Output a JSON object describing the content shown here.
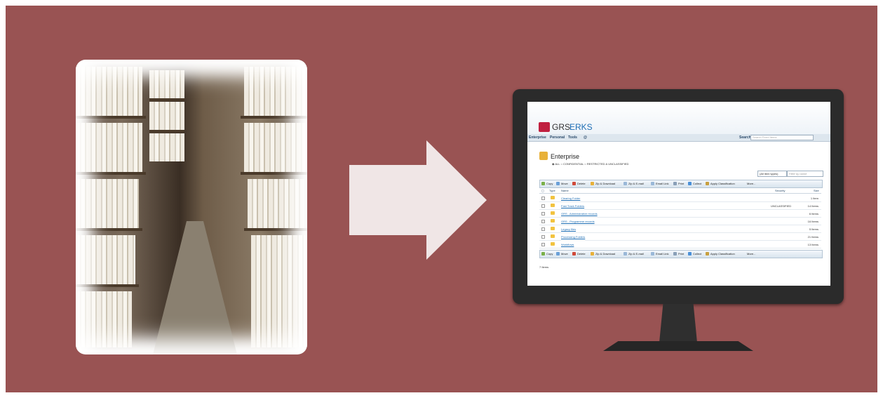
{
  "app": {
    "logo_primary": "GRS",
    "logo_secondary": "ERKS"
  },
  "nav": {
    "items": [
      "Enterprise",
      "Personal",
      "Tools",
      "@"
    ],
    "search_label": "Search",
    "search_placeholder": "Search Fixed Items"
  },
  "container": {
    "title": "Enterprise",
    "radio_options": "◉ ALL ○ CONFIDENTIAL ○ RESTRICTED & UNCLASSIFIED",
    "type_filter": "(All item types)",
    "name_filter_placeholder": "Filter by name"
  },
  "toolbar": [
    "Copy",
    "Move",
    "Delete",
    "Zip & Download",
    "Zip & E-mail",
    "Email Link",
    "Print",
    "Collect",
    "Apply Classification",
    "More..."
  ],
  "columns": {
    "type": "Type",
    "name": "Name",
    "security": "Security",
    "size": "Size"
  },
  "rows": [
    {
      "name": "Clearing Folder",
      "security": "",
      "size": "1 Item"
    },
    {
      "name": "Fast Track Folders",
      "security": "UNCLASSIFIED",
      "size": "14 Items"
    },
    {
      "name": "GRS - Administrative records",
      "security": "",
      "size": "6 Items"
    },
    {
      "name": "GRS - Programme records",
      "security": "",
      "size": "16 Items"
    },
    {
      "name": "Legacy files",
      "security": "",
      "size": "5 Items"
    },
    {
      "name": "Processing Folders",
      "security": "",
      "size": "21 Items"
    },
    {
      "name": "Workflows",
      "security": "",
      "size": "13 Items"
    }
  ],
  "item_count": "7 Items",
  "colors": {
    "slide_bg": "#995353",
    "arrow": "#f0e6e6",
    "monitor_bezel": "#2b2b2b",
    "accent_link": "#1f6fb5"
  }
}
